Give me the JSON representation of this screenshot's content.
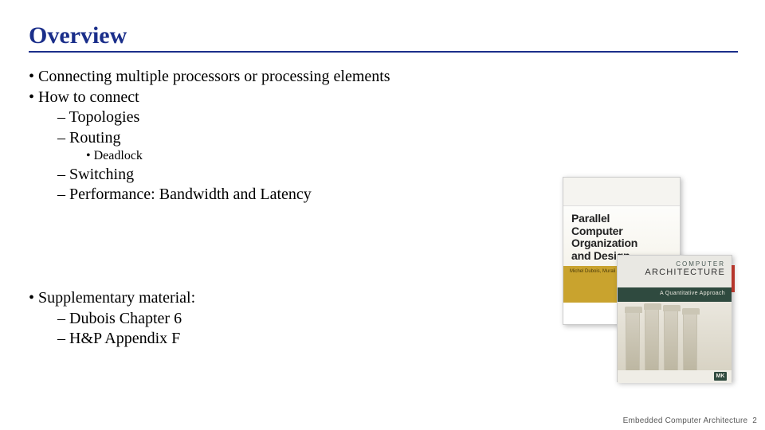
{
  "title": "Overview",
  "bullets": {
    "b1": "Connecting multiple processors or processing elements",
    "b2": "How to connect",
    "b2a": "Topologies",
    "b2b": "Routing",
    "b2b1": "Deadlock",
    "b2c": "Switching",
    "b2d": "Performance: Bandwidth and Latency",
    "b3": "Supplementary material:",
    "b3a": "Dubois Chapter 6",
    "b3b": "H&P Appendix F"
  },
  "books": {
    "book1": {
      "title_l1": "Parallel",
      "title_l2": "Computer",
      "title_l3": "Organization",
      "title_l4": "and Design",
      "authors": "Michel Dubois, Murali Annavaram …"
    },
    "book2": {
      "pretitle": "COMPUTER",
      "title": "ARCHITECTURE",
      "subtitle": "A Quantitative Approach",
      "publisher_mark": "MK"
    }
  },
  "footer": {
    "text": "Embedded Computer Architecture",
    "page": "2"
  }
}
